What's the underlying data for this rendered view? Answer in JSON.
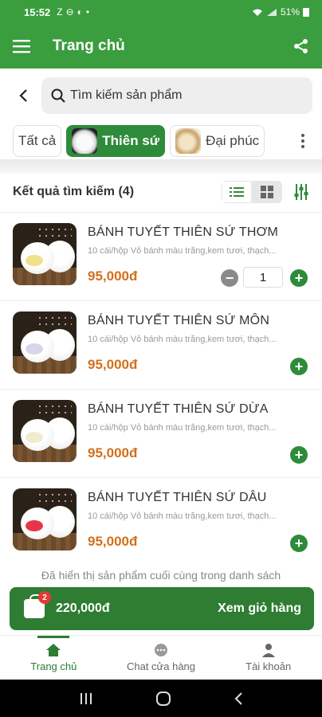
{
  "status_bar": {
    "time": "15:52",
    "left_icons": [
      "Z",
      "⊖",
      "◐",
      "•"
    ],
    "battery": "51%"
  },
  "app_bar": {
    "title": "Trang chủ",
    "menu_icon": "hamburger-menu-icon",
    "share_icon": "share-icon"
  },
  "search": {
    "placeholder": "Tìm kiếm sản phẩm"
  },
  "chips": [
    {
      "label": "Tất cả",
      "active": false
    },
    {
      "label": "Thiên sứ",
      "active": true
    },
    {
      "label": "Đại phúc",
      "active": false
    }
  ],
  "results": {
    "label": "Kết quả tìm kiếm (4)"
  },
  "products": [
    {
      "name": "BÁNH TUYẾT THIÊN SỨ THƠM",
      "desc": "10 cái/hộp Vỏ bánh màu trắng,kem tươi, thạch...",
      "price": "95,000đ",
      "qty": "1",
      "filling_color": "#f1e08a"
    },
    {
      "name": "BÁNH TUYẾT THIÊN SỨ MÔN",
      "desc": "10 cái/hộp Vỏ bánh màu trắng,kem tươi, thạch...",
      "price": "95,000đ",
      "filling_color": "#d9d4e8"
    },
    {
      "name": "BÁNH TUYẾT THIÊN SỨ DỪA",
      "desc": "10 cái/hộp Vỏ bánh màu trắng,kem tươi, thạch...",
      "price": "95,000đ",
      "filling_color": "#f0eccf"
    },
    {
      "name": "BÁNH TUYẾT THIÊN SỨ DÂU",
      "desc": "10 cái/hộp Vỏ bánh màu trắng,kem tươi, thạch...",
      "price": "95,000đ",
      "filling_color": "#e8344a"
    }
  ],
  "end_note": "Đã hiển thị sản phẩm cuối cùng trong danh sách",
  "cart": {
    "badge": "2",
    "total": "220,000đ",
    "view_label": "Xem giỏ hàng"
  },
  "bottom_nav": [
    {
      "label": "Trang chủ",
      "icon": "home-icon",
      "active": true
    },
    {
      "label": "Chat cửa hàng",
      "icon": "chat-icon",
      "active": false
    },
    {
      "label": "Tài khoản",
      "icon": "user-icon",
      "active": false
    }
  ],
  "colors": {
    "primary": "#3a9d3e",
    "price": "#d26f1b",
    "badge": "#e53935"
  }
}
